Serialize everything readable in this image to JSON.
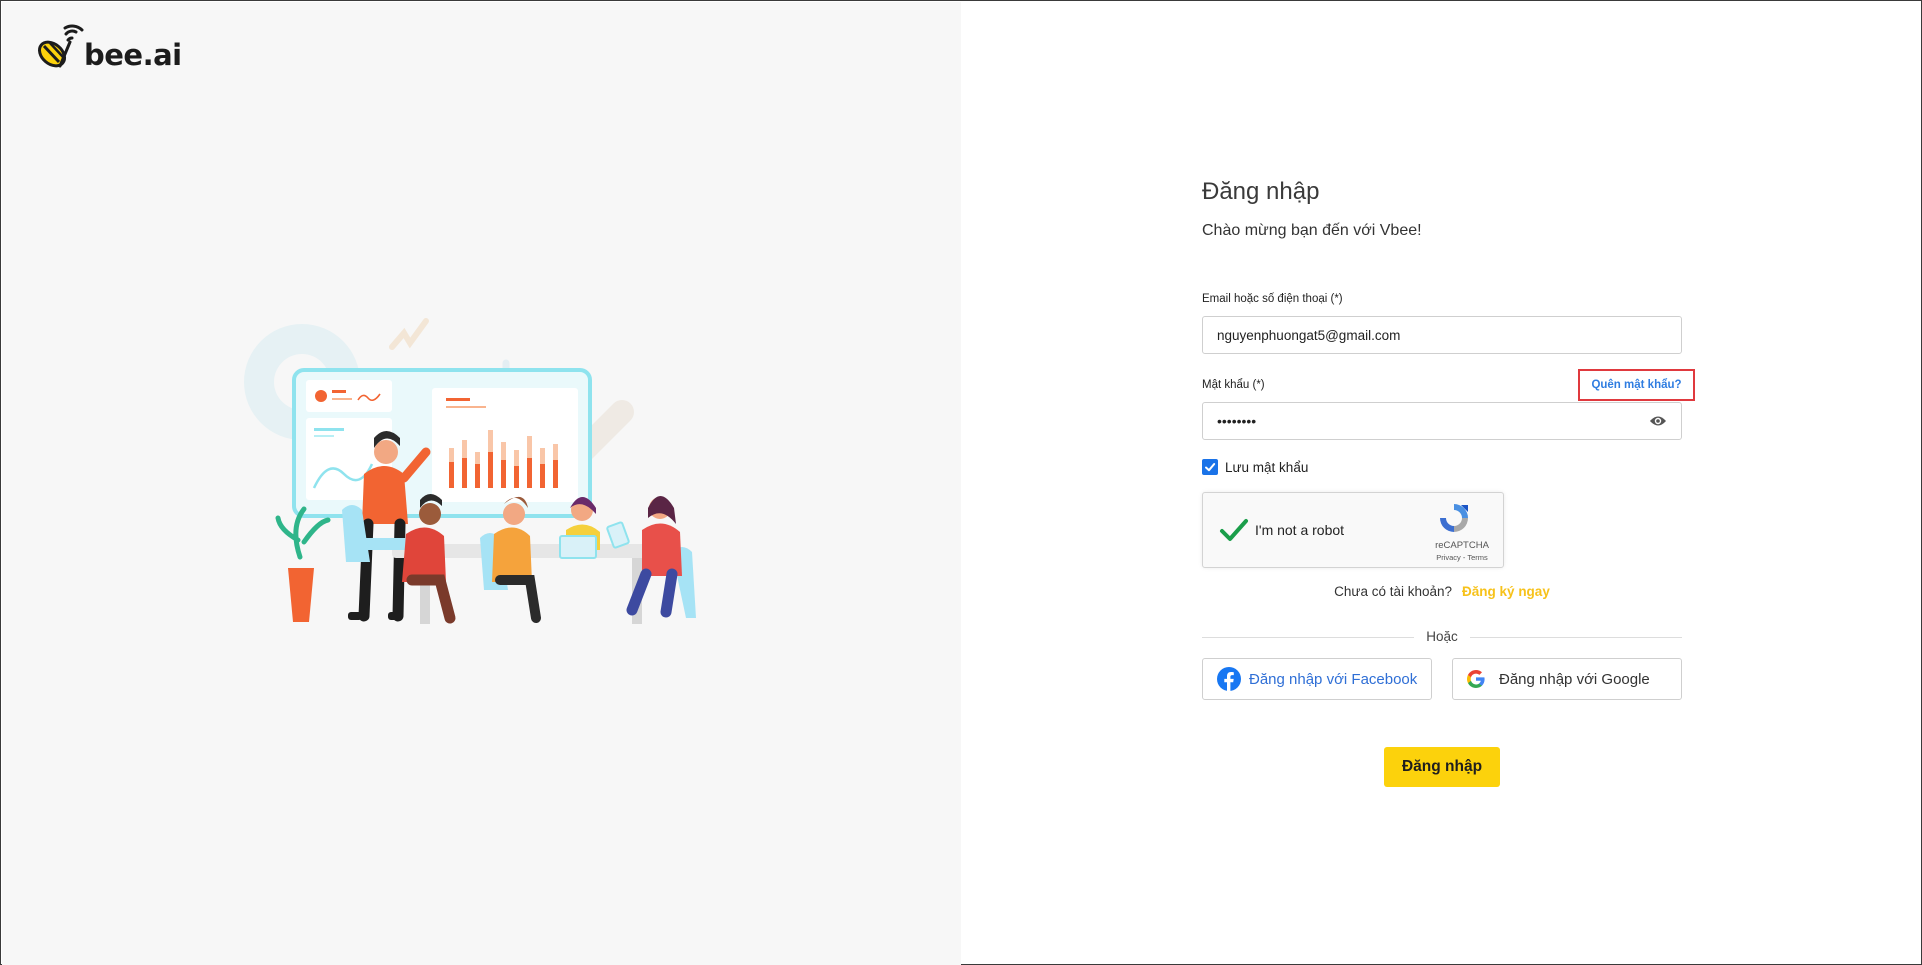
{
  "brand": {
    "logo_text": "bee.ai",
    "accent_color": "#fcd20c"
  },
  "login": {
    "title": "Đăng nhập",
    "subtitle": "Chào mừng bạn đến với Vbee!",
    "email_label": "Email hoặc số điện thoại (*)",
    "email_value": "nguyenphuongat5@gmail.com",
    "password_label": "Mật khẩu (*)",
    "password_value": "••••••••",
    "forgot_link": "Quên mật khẩu?",
    "remember_label": "Lưu mật khẩu",
    "remember_checked": true,
    "no_account_text": "Chưa có tài khoản?",
    "signup_link": "Đăng ký ngay",
    "or_text": "Hoặc",
    "facebook_button": "Đăng nhập với Facebook",
    "google_button": "Đăng nhập với Google",
    "submit_button": "Đăng nhập"
  },
  "recaptcha": {
    "label": "I'm not a robot",
    "brand": "reCAPTCHA",
    "terms": "Privacy - Terms"
  },
  "icons": {
    "eye": "eye-icon",
    "checkmark": "check-icon",
    "facebook": "facebook-icon",
    "google": "google-icon",
    "recaptcha": "recaptcha-icon"
  }
}
